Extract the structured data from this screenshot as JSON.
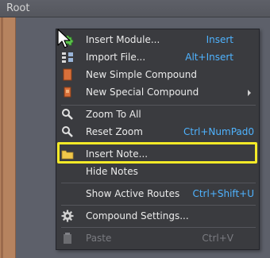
{
  "header": {
    "title": "Root"
  },
  "menu": {
    "items": [
      {
        "label": "Insert Module...",
        "shortcut": "Insert",
        "icon": "puzzle-icon"
      },
      {
        "label": "Import File...",
        "shortcut": "Alt+Insert",
        "icon": "import-file-icon"
      },
      {
        "label": "New Simple Compound",
        "shortcut": "",
        "icon": "simple-compound-icon"
      },
      {
        "label": "New Special Compound",
        "shortcut": "",
        "icon": "special-compound-icon",
        "submenu": true
      },
      {
        "label": "Zoom To All",
        "shortcut": "",
        "icon": "magnifier-icon"
      },
      {
        "label": "Reset Zoom",
        "shortcut": "Ctrl+NumPad0",
        "icon": "magnifier-icon"
      },
      {
        "label": "Insert Note...",
        "shortcut": "",
        "icon": "folder-icon"
      },
      {
        "label": "Hide Notes",
        "shortcut": "",
        "icon": ""
      },
      {
        "label": "Show Active Routes",
        "shortcut": "Ctrl+Shift+U",
        "icon": ""
      },
      {
        "label": "Compound Settings...",
        "shortcut": "",
        "icon": "gear-icon"
      },
      {
        "label": "Paste",
        "shortcut": "Ctrl+V",
        "icon": "paste-icon",
        "disabled": true
      }
    ]
  },
  "colors": {
    "accent_shortcut": "#4fb3ff",
    "highlight": "#f4ea28",
    "menu_bg": "#3a3b3f"
  }
}
